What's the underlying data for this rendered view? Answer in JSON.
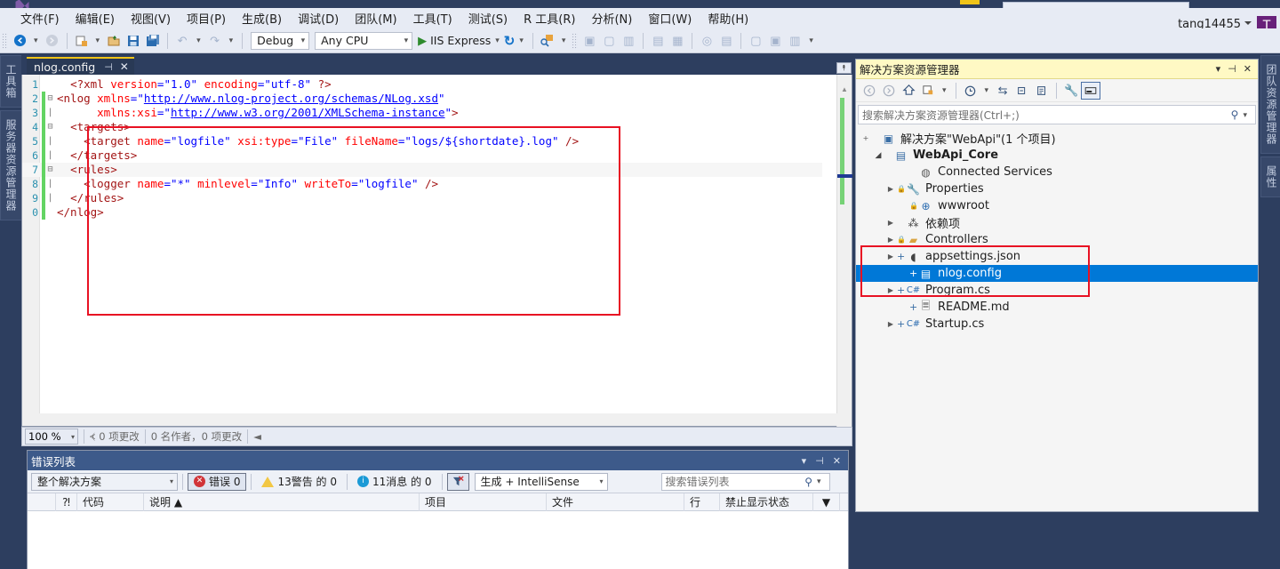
{
  "window": {
    "account_name": "tang14455",
    "account_initial": "T"
  },
  "menubar": {
    "items": [
      {
        "label": "文件(F)",
        "name": "menu-file"
      },
      {
        "label": "编辑(E)",
        "name": "menu-edit"
      },
      {
        "label": "视图(V)",
        "name": "menu-view"
      },
      {
        "label": "项目(P)",
        "name": "menu-project"
      },
      {
        "label": "生成(B)",
        "name": "menu-build"
      },
      {
        "label": "调试(D)",
        "name": "menu-debug"
      },
      {
        "label": "团队(M)",
        "name": "menu-team"
      },
      {
        "label": "工具(T)",
        "name": "menu-tools"
      },
      {
        "label": "测试(S)",
        "name": "menu-test"
      },
      {
        "label": "R 工具(R)",
        "name": "menu-rtools"
      },
      {
        "label": "分析(N)",
        "name": "menu-analyze"
      },
      {
        "label": "窗口(W)",
        "name": "menu-window"
      },
      {
        "label": "帮助(H)",
        "name": "menu-help"
      }
    ]
  },
  "toolbar": {
    "config_value": "Debug",
    "platform_value": "Any CPU",
    "run_label": "IIS Express",
    "icons": {
      "back": "◄",
      "forward": "►",
      "new_project": "▣",
      "open": "▤",
      "save": "▦",
      "save_all": "▩",
      "undo": "↶",
      "redo": "↷",
      "play": "▶",
      "refresh": "↻",
      "find": "⚲"
    }
  },
  "dock_tabs": {
    "left": [
      "工具箱",
      "服务器资源管理器"
    ],
    "right": [
      "团队资源管理器",
      "属性"
    ]
  },
  "editor": {
    "tab_label": "nlog.config",
    "tab_pin_icon": "⊣",
    "tab_close_icon": "✕",
    "status": {
      "zoom": "100 %",
      "changes": "0 项更改",
      "authors": "0 名作者，0 项更改"
    },
    "lines": [
      {
        "num": "1",
        "fold": "",
        "changed": false,
        "highlight": false,
        "segments": [
          {
            "t": "  ",
            "c": ""
          },
          {
            "t": "<?xml ",
            "c": "k-proc"
          },
          {
            "t": "version",
            "c": "k-attr"
          },
          {
            "t": "=",
            "c": "k-punct"
          },
          {
            "t": "\"1.0\"",
            "c": "k-val"
          },
          {
            "t": " ",
            "c": ""
          },
          {
            "t": "encoding",
            "c": "k-attr"
          },
          {
            "t": "=",
            "c": "k-punct"
          },
          {
            "t": "\"utf-8\"",
            "c": "k-val"
          },
          {
            "t": " ?>",
            "c": "k-proc"
          }
        ]
      },
      {
        "num": "2",
        "fold": "⊟",
        "changed": true,
        "highlight": false,
        "segments": [
          {
            "t": "<nlog ",
            "c": "k-tag"
          },
          {
            "t": "xmlns",
            "c": "k-attr"
          },
          {
            "t": "=",
            "c": "k-punct"
          },
          {
            "t": "\"",
            "c": "k-val"
          },
          {
            "t": "http://www.nlog-project.org/schemas/NLog.xsd",
            "c": "k-link"
          },
          {
            "t": "\"",
            "c": "k-val"
          }
        ]
      },
      {
        "num": "3",
        "fold": "|",
        "changed": true,
        "highlight": false,
        "segments": [
          {
            "t": "      ",
            "c": ""
          },
          {
            "t": "xmlns:xsi",
            "c": "k-attr"
          },
          {
            "t": "=",
            "c": "k-punct"
          },
          {
            "t": "\"",
            "c": "k-val"
          },
          {
            "t": "http://www.w3.org/2001/XMLSchema-instance",
            "c": "k-link"
          },
          {
            "t": "\"",
            "c": "k-val"
          },
          {
            "t": ">",
            "c": "k-tag"
          }
        ]
      },
      {
        "num": "4",
        "fold": "⊟",
        "changed": true,
        "highlight": false,
        "segments": [
          {
            "t": "  ",
            "c": ""
          },
          {
            "t": "<targets>",
            "c": "k-tag"
          }
        ]
      },
      {
        "num": "5",
        "fold": "|",
        "changed": true,
        "highlight": false,
        "segments": [
          {
            "t": "    ",
            "c": ""
          },
          {
            "t": "<target ",
            "c": "k-tag"
          },
          {
            "t": "name",
            "c": "k-attr"
          },
          {
            "t": "=",
            "c": "k-punct"
          },
          {
            "t": "\"logfile\"",
            "c": "k-val"
          },
          {
            "t": " ",
            "c": ""
          },
          {
            "t": "xsi:type",
            "c": "k-attr"
          },
          {
            "t": "=",
            "c": "k-punct"
          },
          {
            "t": "\"File\"",
            "c": "k-val"
          },
          {
            "t": " ",
            "c": ""
          },
          {
            "t": "fileName",
            "c": "k-attr"
          },
          {
            "t": "=",
            "c": "k-punct"
          },
          {
            "t": "\"logs/${shortdate}.log\"",
            "c": "k-val"
          },
          {
            "t": " />",
            "c": "k-tag"
          }
        ]
      },
      {
        "num": "6",
        "fold": "|",
        "changed": true,
        "highlight": false,
        "segments": [
          {
            "t": "  ",
            "c": ""
          },
          {
            "t": "</targets>",
            "c": "k-tag"
          }
        ]
      },
      {
        "num": "7",
        "fold": "⊟",
        "changed": true,
        "highlight": true,
        "segments": [
          {
            "t": "  ",
            "c": ""
          },
          {
            "t": "<rules>",
            "c": "k-tag"
          }
        ]
      },
      {
        "num": "8",
        "fold": "|",
        "changed": true,
        "highlight": false,
        "segments": [
          {
            "t": "    ",
            "c": ""
          },
          {
            "t": "<logger ",
            "c": "k-tag"
          },
          {
            "t": "name",
            "c": "k-attr"
          },
          {
            "t": "=",
            "c": "k-punct"
          },
          {
            "t": "\"*\"",
            "c": "k-val"
          },
          {
            "t": " ",
            "c": ""
          },
          {
            "t": "minlevel",
            "c": "k-attr"
          },
          {
            "t": "=",
            "c": "k-punct"
          },
          {
            "t": "\"Info\"",
            "c": "k-val"
          },
          {
            "t": " ",
            "c": ""
          },
          {
            "t": "writeTo",
            "c": "k-attr"
          },
          {
            "t": "=",
            "c": "k-punct"
          },
          {
            "t": "\"logfile\"",
            "c": "k-val"
          },
          {
            "t": " />",
            "c": "k-tag"
          }
        ]
      },
      {
        "num": "9",
        "fold": "|",
        "changed": true,
        "highlight": false,
        "segments": [
          {
            "t": "  ",
            "c": ""
          },
          {
            "t": "</rules>",
            "c": "k-tag"
          }
        ]
      },
      {
        "num": "0",
        "fold": "",
        "changed": true,
        "highlight": false,
        "segments": [
          {
            "t": "</nlog>",
            "c": "k-tag"
          }
        ]
      }
    ]
  },
  "solution_explorer": {
    "title": "解决方案资源管理器",
    "search_placeholder": "搜索解决方案资源管理器(Ctrl+;)",
    "header_icons": {
      "dropdown": "▾",
      "pin": "⊣",
      "close": "✕"
    },
    "toolbar_icons": [
      "◐",
      "◑",
      "⌂",
      "▣",
      "▾",
      "◷",
      "▾",
      "⇄",
      "❐",
      "⎘",
      "🔧",
      "▬"
    ],
    "tree": [
      {
        "indent": 0,
        "twisty": "+",
        "plus": "",
        "icon": "▣",
        "icon_color": "#3a6ea5",
        "label": "解决方案\"WebApi\"(1 个项目)",
        "bold": false,
        "selected": false,
        "name": "tree-node-solution"
      },
      {
        "indent": 1,
        "twisty": "▲",
        "plus": "",
        "icon": "▤",
        "icon_color": "#3a6ea5",
        "label": "WebApi_Core",
        "bold": true,
        "selected": false,
        "name": "tree-node-webapi-core"
      },
      {
        "indent": 3,
        "twisty": "",
        "plus": "",
        "icon": "◍",
        "icon_color": "#5a5a5a",
        "label": "Connected Services",
        "bold": false,
        "selected": false,
        "name": "tree-node-connected-services"
      },
      {
        "indent": 2,
        "twisty": "▶",
        "plus": "🔒",
        "icon": "🔧",
        "icon_color": "#2b6cb0",
        "label": "Properties",
        "bold": false,
        "selected": false,
        "name": "tree-node-properties"
      },
      {
        "indent": 3,
        "twisty": "",
        "plus": "🔒",
        "icon": "⊕",
        "icon_color": "#2b6cb0",
        "label": "wwwroot",
        "bold": false,
        "selected": false,
        "name": "tree-node-wwwroot"
      },
      {
        "indent": 2,
        "twisty": "▶",
        "plus": "",
        "icon": "⁂",
        "icon_color": "#444",
        "label": "依赖项",
        "bold": false,
        "selected": false,
        "name": "tree-node-dependencies"
      },
      {
        "indent": 2,
        "twisty": "▶",
        "plus": "🔒",
        "icon": "▰",
        "icon_color": "#d9a441",
        "label": "Controllers",
        "bold": false,
        "selected": false,
        "name": "tree-node-controllers"
      },
      {
        "indent": 2,
        "twisty": "▶",
        "plus": "+",
        "icon": "◖",
        "icon_color": "#444",
        "label": "appsettings.json",
        "bold": false,
        "selected": false,
        "name": "tree-node-appsettings-json"
      },
      {
        "indent": 3,
        "twisty": "",
        "plus": "+",
        "icon": "▤",
        "icon_color": "#444",
        "label": "nlog.config",
        "bold": false,
        "selected": true,
        "name": "tree-node-nlog-config"
      },
      {
        "indent": 2,
        "twisty": "▶",
        "plus": "+",
        "icon": "C#",
        "icon_color": "#2b6cb0",
        "label": "Program.cs",
        "bold": false,
        "selected": false,
        "name": "tree-node-program-cs"
      },
      {
        "indent": 3,
        "twisty": "",
        "plus": "+",
        "icon": "🗏",
        "icon_color": "#444",
        "label": "README.md",
        "bold": false,
        "selected": false,
        "name": "tree-node-readme-md"
      },
      {
        "indent": 2,
        "twisty": "▶",
        "plus": "+",
        "icon": "C#",
        "icon_color": "#2b6cb0",
        "label": "Startup.cs",
        "bold": false,
        "selected": false,
        "name": "tree-node-startup-cs"
      }
    ]
  },
  "error_list": {
    "title": "错误列表",
    "header_icons": {
      "dropdown": "▾",
      "pin": "⊣",
      "close": "✕"
    },
    "scope_value": "整个解决方案",
    "errors_label": "错误 0",
    "warnings_label": "13警告 的 0",
    "messages_label": "11消息 的 0",
    "source_value": "生成 + IntelliSense",
    "search_placeholder": "搜索错误列表",
    "columns": [
      "",
      "",
      "代码",
      "说明 ▲",
      "项目",
      "文件",
      "行",
      "禁止显示状态",
      ""
    ],
    "rows": []
  },
  "colors": {
    "accent_blue": "#0078d7",
    "annotation_red": "#e81123",
    "panel_yellow": "#fff9c4",
    "chrome_blue": "#2d3e5f"
  }
}
